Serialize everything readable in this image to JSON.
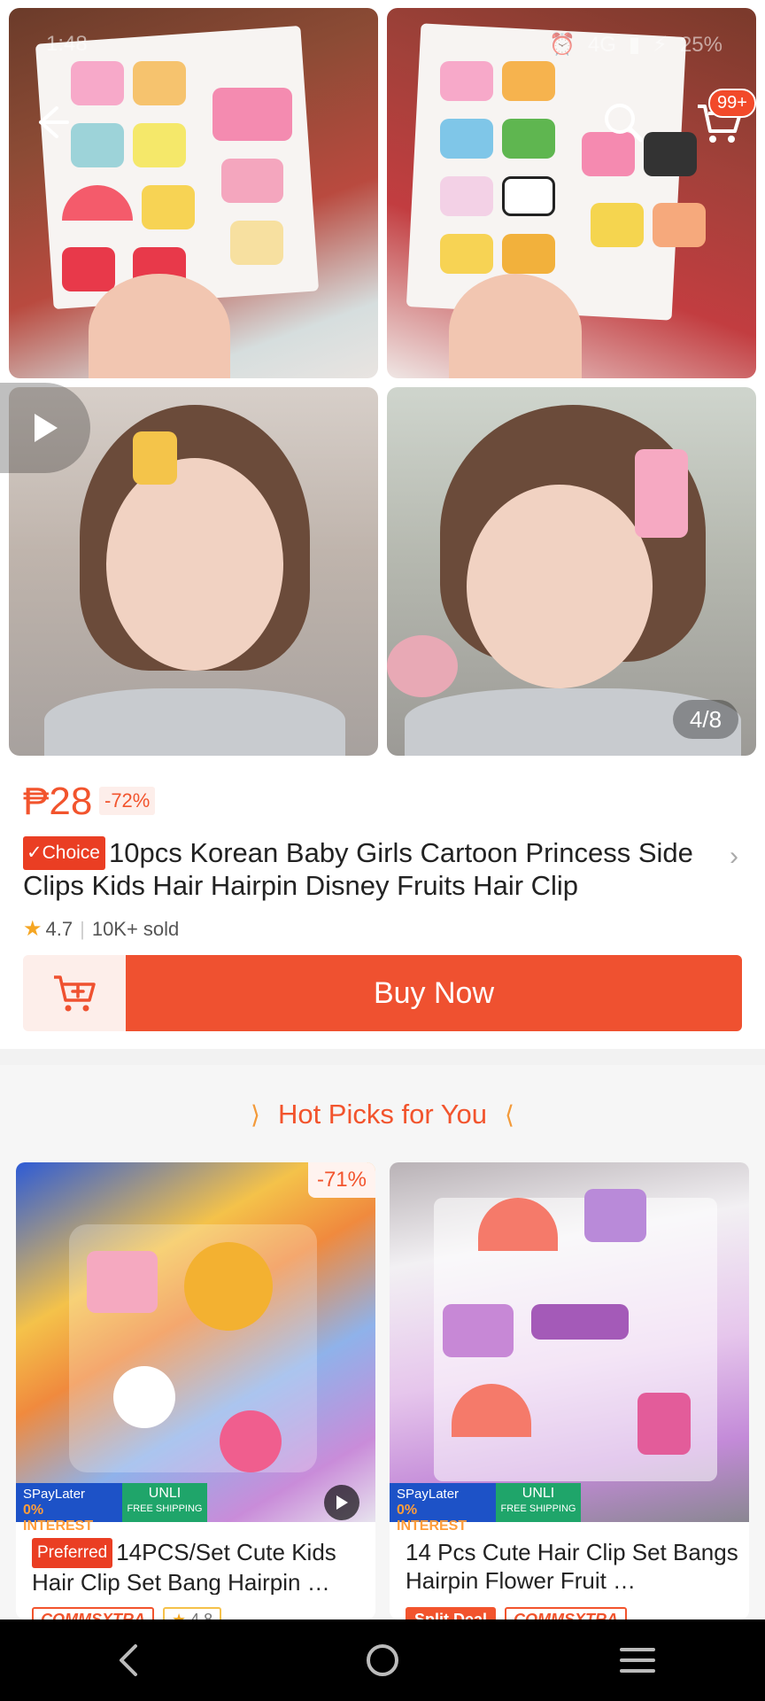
{
  "status_bar": {
    "time": "1:48",
    "network": "4G",
    "battery": "25%"
  },
  "gallery": {
    "counter": "4/8",
    "cart_badge": "99+"
  },
  "product": {
    "price": "₱28",
    "discount": "-72%",
    "badge": "Choice",
    "title": "10pcs Korean Baby Girls Cartoon Princess Side Clips Kids Hair Hairpin Disney Fruits Hair Clip",
    "rating": "4.7",
    "sold": "10K+ sold"
  },
  "actions": {
    "buy_now": "Buy Now"
  },
  "hot_picks": {
    "title": "Hot Picks for You",
    "items": [
      {
        "discount": "-71%",
        "badge": "Preferred",
        "title": "14PCS/Set Cute Kids Hair Clip Set Bang Hairpin …",
        "promo_spay": "SPayLater",
        "promo_interest": "0% INTEREST",
        "promo_unli": "UNLI",
        "promo_shipping": "FREE SHIPPING",
        "tag1": "COMMSXTRA",
        "tag2": "4.8"
      },
      {
        "title": "14 Pcs Cute Hair Clip Set Bangs Hairpin Flower Fruit …",
        "promo_spay": "SPayLater",
        "promo_interest": "0% INTEREST",
        "promo_unli": "UNLI",
        "promo_shipping": "FREE SHIPPING",
        "tag1": "Split Deal",
        "tag2": "COMMSXTRA"
      }
    ]
  },
  "colors": {
    "accent": "#ef5130",
    "accent_light": "#fdeeea",
    "star": "#f5a623"
  }
}
